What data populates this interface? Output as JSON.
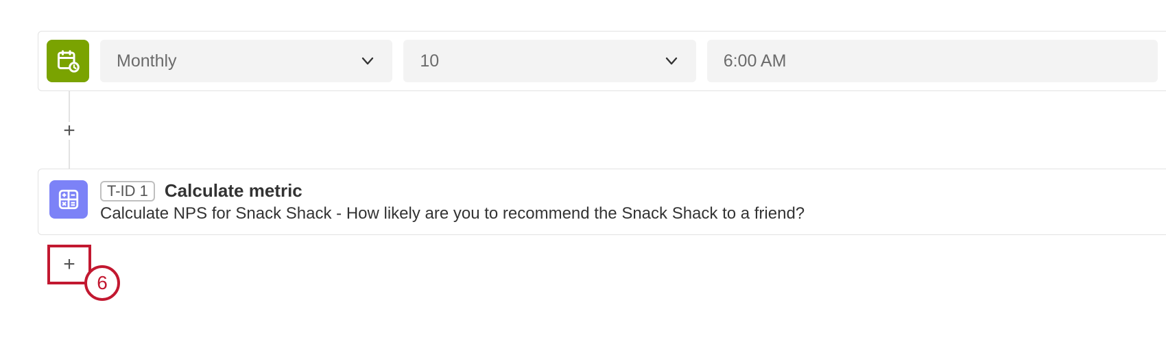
{
  "schedule": {
    "frequency": "Monthly",
    "day": "10",
    "time": "6:00 AM"
  },
  "task": {
    "id_label": "T-ID 1",
    "title": "Calculate metric",
    "description": "Calculate NPS for Snack Shack - How likely are you to recommend the Snack Shack to a friend?"
  },
  "callout": {
    "number": "6"
  }
}
